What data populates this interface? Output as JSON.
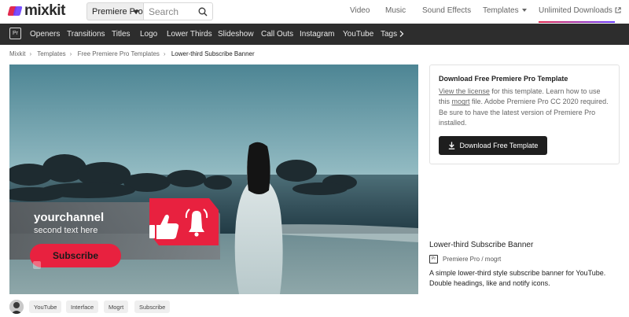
{
  "header": {
    "logo_text": "mixkit",
    "product_select": "Premiere Pro",
    "search_placeholder": "Search",
    "nav": {
      "video": "Video",
      "music": "Music",
      "sound_effects": "Sound Effects",
      "templates": "Templates",
      "unlimited": "Unlimited Downloads"
    }
  },
  "subnav": {
    "badge": "Pr",
    "items": [
      "Openers",
      "Transitions",
      "Titles",
      "Logo",
      "Lower Thirds",
      "Slideshow",
      "Call Outs",
      "Instagram",
      "YouTube",
      "Tags"
    ]
  },
  "breadcrumb": [
    "Mixkit",
    "Templates",
    "Free Premiere Pro Templates",
    "Lower-third Subscribe Banner"
  ],
  "preview": {
    "channel": "yourchannel",
    "second_text": "second text here",
    "subscribe": "Subscribe"
  },
  "card": {
    "title": "Download Free Premiere Pro Template",
    "license_link": "View the license",
    "text_1": " for this template. Learn how to use this ",
    "mogrt_link": "mogrt",
    "text_2": " file. Adobe Premiere Pro CC 2020 required. Be sure to have the latest version of Premiere Pro installed.",
    "button": "Download Free Template"
  },
  "item": {
    "title": "Lower-third Subscribe Banner",
    "meta_badge": "Pr",
    "meta": "Premiere Pro / mogrt",
    "description": "A simple lower-third style subscribe banner for YouTube. Double headings, like and notify icons."
  },
  "tags": [
    "YouTube",
    "Interface",
    "Mogrt",
    "Subscribe"
  ],
  "colors": {
    "brand_red": "#e22a4f",
    "brand_purple": "#6a3cff",
    "subnav_bg": "#2d2d2d",
    "button_bg": "#1e1e1e",
    "banner_red": "#e8213f"
  }
}
